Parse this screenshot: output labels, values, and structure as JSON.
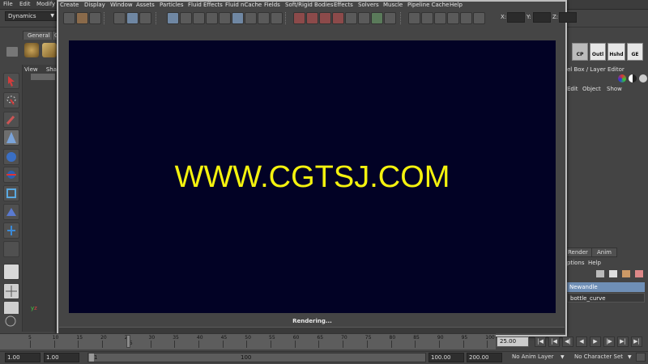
{
  "main_menu": [
    "File",
    "Edit",
    "Modify"
  ],
  "mode_select": "Dynamics",
  "shelf_tabs": [
    "General",
    "C"
  ],
  "viewport_menu": [
    "View",
    "Shad"
  ],
  "render_window": {
    "menu": [
      "Create",
      "Display",
      "Window",
      "Assets",
      "Particles",
      "Fluid Effects",
      "Fluid nCache",
      "Fields",
      "Soft/Rigid Bodies",
      "Effects",
      "Solvers",
      "Muscle",
      "Pipeline Cache",
      "Help"
    ],
    "watermark": "WWW.CGTSJ.COM",
    "status": "Rendering...",
    "field_x": "X:",
    "field_y": "Y:",
    "field_z": "Z:"
  },
  "right_shelf": [
    "CP",
    "Outl",
    "Hshd",
    "GE"
  ],
  "channel_box": {
    "title": "el Box / Layer Editor",
    "menu": [
      "Edit",
      "Object",
      "Show"
    ]
  },
  "layer_editor": {
    "tabs": [
      "Render",
      "Anim"
    ],
    "menu": [
      "ptions",
      "Help"
    ],
    "layers": [
      {
        "name": "Newandle",
        "selected": true
      },
      {
        "name": "bottle_curve",
        "selected": false
      }
    ]
  },
  "timeline": {
    "ticks": [
      "5",
      "10",
      "15",
      "20",
      "25",
      "30",
      "35",
      "40",
      "45",
      "50",
      "55",
      "60",
      "65",
      "70",
      "75",
      "80",
      "85",
      "90",
      "95",
      "100"
    ],
    "current_frame": "25",
    "current_time_field": "25.00"
  },
  "range": {
    "start_time": "1.00",
    "playback_start": "1.00",
    "range_start": "1",
    "range_end": "100",
    "playback_end": "100.00",
    "end_time": "200.00",
    "anim_layer": "No Anim Layer",
    "character_set": "No Character Set"
  },
  "colors": {
    "render_bg": "#020225",
    "watermark": "#f4f20e",
    "selected_layer": "#6f8fb6"
  }
}
